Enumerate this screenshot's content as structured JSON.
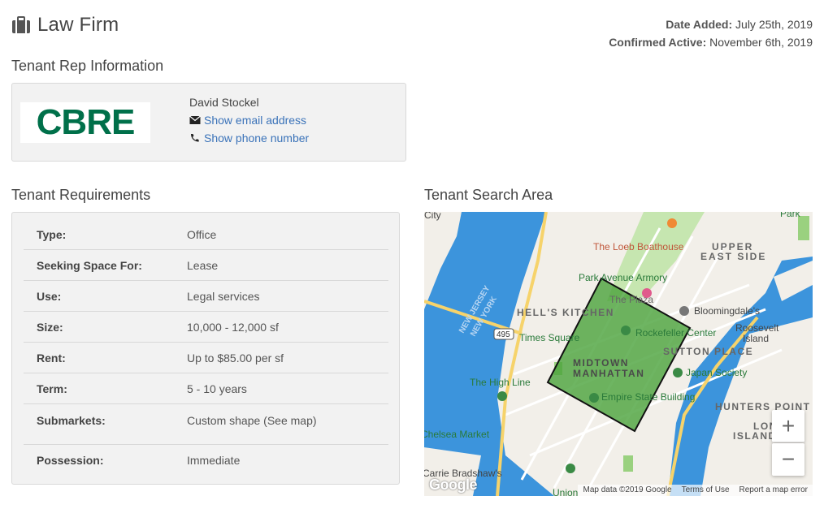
{
  "header": {
    "title": "Law Firm",
    "date_added_label": "Date Added:",
    "date_added_value": "July 25th, 2019",
    "confirmed_label": "Confirmed Active:",
    "confirmed_value": "November 6th, 2019"
  },
  "tenant_rep": {
    "section_title": "Tenant Rep Information",
    "logo_text": "CBRE",
    "name": "David Stockel",
    "email_link": "Show email address",
    "phone_link": "Show phone number"
  },
  "requirements": {
    "section_title": "Tenant Requirements",
    "rows": [
      {
        "label": "Type:",
        "value": "Office"
      },
      {
        "label": "Seeking Space For:",
        "value": "Lease"
      },
      {
        "label": "Use:",
        "value": "Legal services"
      },
      {
        "label": "Size:",
        "value": "10,000 - 12,000 sf"
      },
      {
        "label": "Rent:",
        "value": "Up to $85.00 per sf"
      },
      {
        "label": "Term:",
        "value": "5 - 10 years"
      },
      {
        "label": "Submarkets:",
        "value": "Custom shape (See map)"
      },
      {
        "label": "Possession:",
        "value": "Immediate"
      }
    ]
  },
  "map": {
    "section_title": "Tenant Search Area",
    "labels": {
      "loeb": "The Loeb Boathouse",
      "upper": "UPPER",
      "east_side": "EAST SIDE",
      "park_ave_armory": "Park Avenue Armory",
      "the_plaza": "The Plaza",
      "hells_kitchen": "HELL'S KITCHEN",
      "bloomingdales": "Bloomingdale's",
      "times_square": "Times Square",
      "rockefeller": "Rockefeller Center",
      "roosevelt": "Roosevelt",
      "island": "Island",
      "midtown": "MIDTOWN",
      "manhattan": "MANHATTAN",
      "sutton_place": "SUTTON PLACE",
      "high_line": "The High Line",
      "japan_society": "Japan Society",
      "empire_state": "Empire State Building",
      "hunters_point": "HUNTERS POINT",
      "long": "LONG",
      "island2": "ISLAND",
      "chelsea_market": "Chelsea Market",
      "carrie": "Carrie Bradshaw's",
      "union": "Union",
      "new_jersey": "NEW JERSEY",
      "new_york": "NEW YORK",
      "route_495": "495",
      "city": "City",
      "park": "Park"
    },
    "zoom_in": "+",
    "zoom_out": "−",
    "google": "Google",
    "footer_data": "Map data ©2019 Google",
    "footer_terms": "Terms of Use",
    "footer_report": "Report a map error",
    "colors": {
      "water": "#3c94dc",
      "land": "#f2efe9",
      "park": "#c6e6b0",
      "search_area": "#4aa33b",
      "link": "#3b73b9",
      "cbre_green": "#00704a"
    }
  }
}
